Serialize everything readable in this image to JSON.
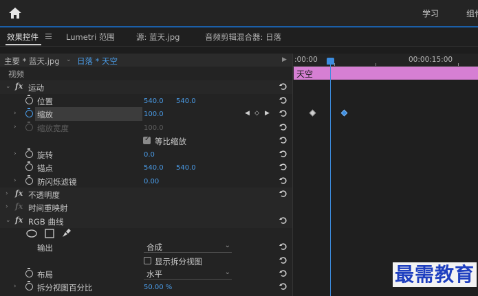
{
  "header": {
    "links": [
      {
        "label": "学习",
        "active": false
      },
      {
        "label": "组件",
        "active": false
      }
    ]
  },
  "panel_tabs": [
    {
      "label": "效果控件",
      "active": true
    },
    {
      "label": "Lumetri 范围",
      "active": false
    },
    {
      "label": "源: 蓝天.jpg",
      "active": false
    },
    {
      "label": "音频剪辑混合器: 日落",
      "active": false
    }
  ],
  "clip_selector": {
    "master": "主要 * 蓝天.jpg",
    "sequence": "日落 * 天空"
  },
  "effects": {
    "section_video": "视频",
    "motion": {
      "label": "运动",
      "position": {
        "label": "位置",
        "x": "540.0",
        "y": "540.0"
      },
      "scale": {
        "label": "缩放",
        "value": "100.0"
      },
      "scale_width": {
        "label": "缩放宽度",
        "value": "100.0"
      },
      "uniform_scale": {
        "label": "等比缩放",
        "checked": true
      },
      "rotation": {
        "label": "旋转",
        "value": "0.0"
      },
      "anchor": {
        "label": "锚点",
        "x": "540.0",
        "y": "540.0"
      },
      "anti_flicker": {
        "label": "防闪烁滤镜",
        "value": "0.00"
      }
    },
    "opacity": {
      "label": "不透明度"
    },
    "time_remap": {
      "label": "时间重映射"
    },
    "rgb_curves": {
      "label": "RGB 曲线",
      "output": {
        "label": "输出",
        "value": "合成"
      },
      "split_view": {
        "label": "显示拆分视图",
        "checked": false
      },
      "layout": {
        "label": "布局",
        "value": "水平"
      },
      "split_percent": {
        "label": "拆分视图百分比",
        "value": "50.00 %"
      }
    }
  },
  "timeline": {
    "timecodes": [
      ":00:00",
      "00:00:15:00"
    ],
    "clip_label": "天空"
  },
  "watermark": "最需教育",
  "colors": {
    "accent": "#4a9be6",
    "clip": "#d67fd3",
    "playhead": "#3c8de0"
  }
}
